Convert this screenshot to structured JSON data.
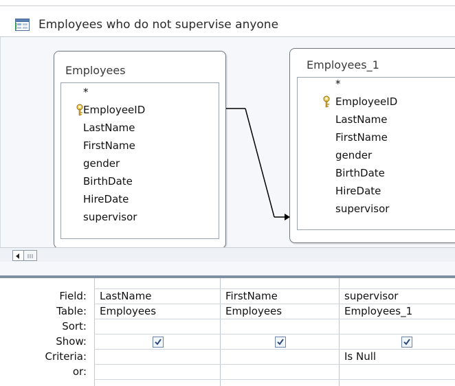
{
  "window": {
    "title": "Employees who do not supervise anyone"
  },
  "tables": [
    {
      "title": "Employees",
      "fields": [
        "*",
        "EmployeeID",
        "LastName",
        "FirstName",
        "gender",
        "BirthDate",
        "HireDate",
        "supervisor"
      ],
      "primary_key": "EmployeeID"
    },
    {
      "title": "Employees_1",
      "fields": [
        "*",
        "EmployeeID",
        "LastName",
        "FirstName",
        "gender",
        "BirthDate",
        "HireDate",
        "supervisor"
      ],
      "primary_key": "EmployeeID"
    }
  ],
  "relationship": {
    "from": "Employees.EmployeeID",
    "to": "Employees_1.supervisor"
  },
  "grid": {
    "row_labels": [
      "Field:",
      "Table:",
      "Sort:",
      "Show:",
      "Criteria:",
      "or:"
    ],
    "columns": [
      {
        "field": "LastName",
        "table": "Employees",
        "sort": "",
        "show": true,
        "criteria": ""
      },
      {
        "field": "FirstName",
        "table": "Employees",
        "sort": "",
        "show": true,
        "criteria": ""
      },
      {
        "field": "supervisor",
        "table": "Employees_1",
        "sort": "",
        "show": true,
        "criteria": "Is Null"
      }
    ]
  },
  "icons": {
    "title": "query-design-icon",
    "key": "primary-key-icon",
    "scroll_left": "scroll-left-arrow-icon",
    "check": "checkmark-icon"
  }
}
